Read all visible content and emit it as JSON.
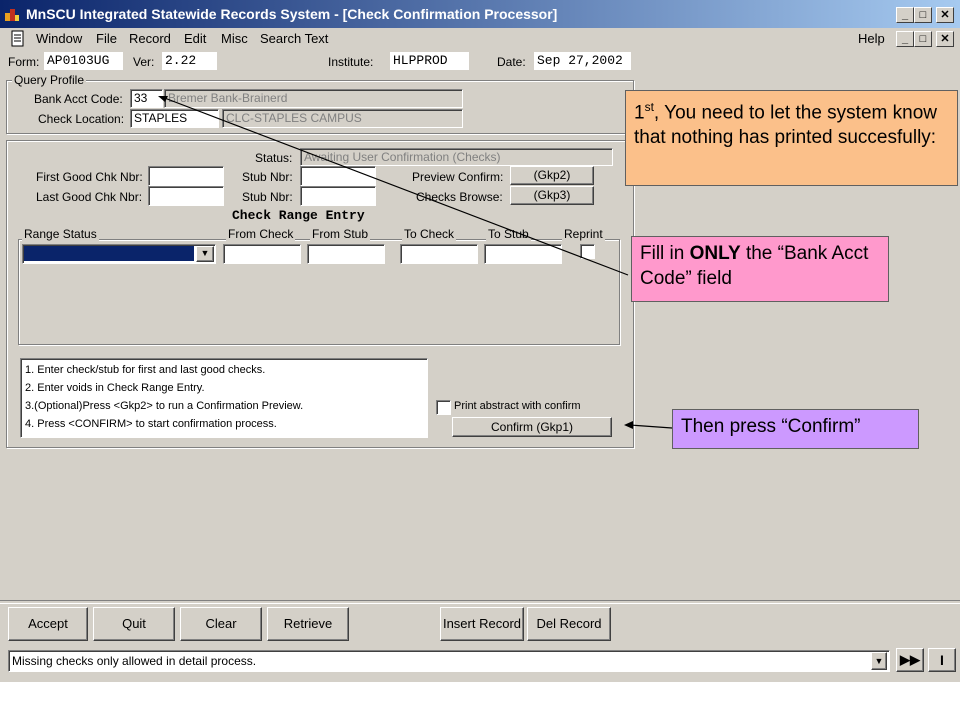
{
  "window": {
    "title": "MnSCU Integrated Statewide Records System - [Check Confirmation Processor]",
    "controls": {
      "minimize": "_",
      "maximize": "□",
      "close": "✕"
    }
  },
  "menu": {
    "items": [
      "Window",
      "File",
      "Record",
      "Edit",
      "Misc",
      "Search Text"
    ],
    "help": "Help"
  },
  "header": {
    "form_label": "Form:",
    "form_value": "AP0103UG",
    "ver_label": "Ver:",
    "ver_value": "2.22",
    "institute_label": "Institute:",
    "institute_value": "HLPPROD",
    "date_label": "Date:",
    "date_value": "Sep 27,2002"
  },
  "query_profile": {
    "title": "Query Profile",
    "bank_acct_label": "Bank Acct Code:",
    "bank_acct_value": "33",
    "bank_name": "Bremer Bank-Brainerd",
    "check_location_label": "Check Location:",
    "check_location_value": "STAPLES",
    "location_name": "CLC-STAPLES CAMPUS"
  },
  "checks": {
    "status_label": "Status:",
    "status_value": "Awaiting User Confirmation (Checks)",
    "first_good_label": "First Good Chk Nbr:",
    "last_good_label": "Last Good Chk Nbr:",
    "stub_nbr_label": "Stub Nbr:",
    "preview_confirm_label": "Preview Confirm:",
    "preview_confirm_button": "(Gkp2)",
    "checks_browse_label": "Checks Browse:",
    "checks_browse_button": "(Gkp3)"
  },
  "range_entry": {
    "title": "Check Range Entry",
    "columns": [
      "Range Status",
      "From Check",
      "From Stub",
      "To Check",
      "To Stub",
      "Reprint"
    ]
  },
  "instructions": [
    "1. Enter check/stub for first and last good checks.",
    "2. Enter voids in Check Range Entry.",
    "3.(Optional)Press <Gkp2> to run a Confirmation Preview.",
    "4. Press <CONFIRM> to start confirmation process."
  ],
  "print_abstract_label": "Print abstract with confirm",
  "confirm_button": "Confirm (Gkp1)",
  "bottom_buttons": [
    "Accept",
    "Quit",
    "Clear",
    "Retrieve",
    "Insert Record",
    "Del Record"
  ],
  "status_message": "Missing checks only allowed in detail process.",
  "callouts": {
    "step1_sup": "st",
    "step1_num": "1",
    "step1_text": ", You need to let the system know that nothing has printed succesfully:",
    "fill_prefix": "Fill in ",
    "fill_bold": "ONLY",
    "fill_suffix": " the “Bank Acct Code” field",
    "confirm_text": "Then press “Confirm”"
  },
  "colors": {
    "titlebar_start": "#0a246a",
    "callout_orange": "#fbc08a",
    "callout_pink": "#ff99cc",
    "callout_purple": "#cc99ff",
    "range_status_selected": "#0a246a"
  }
}
